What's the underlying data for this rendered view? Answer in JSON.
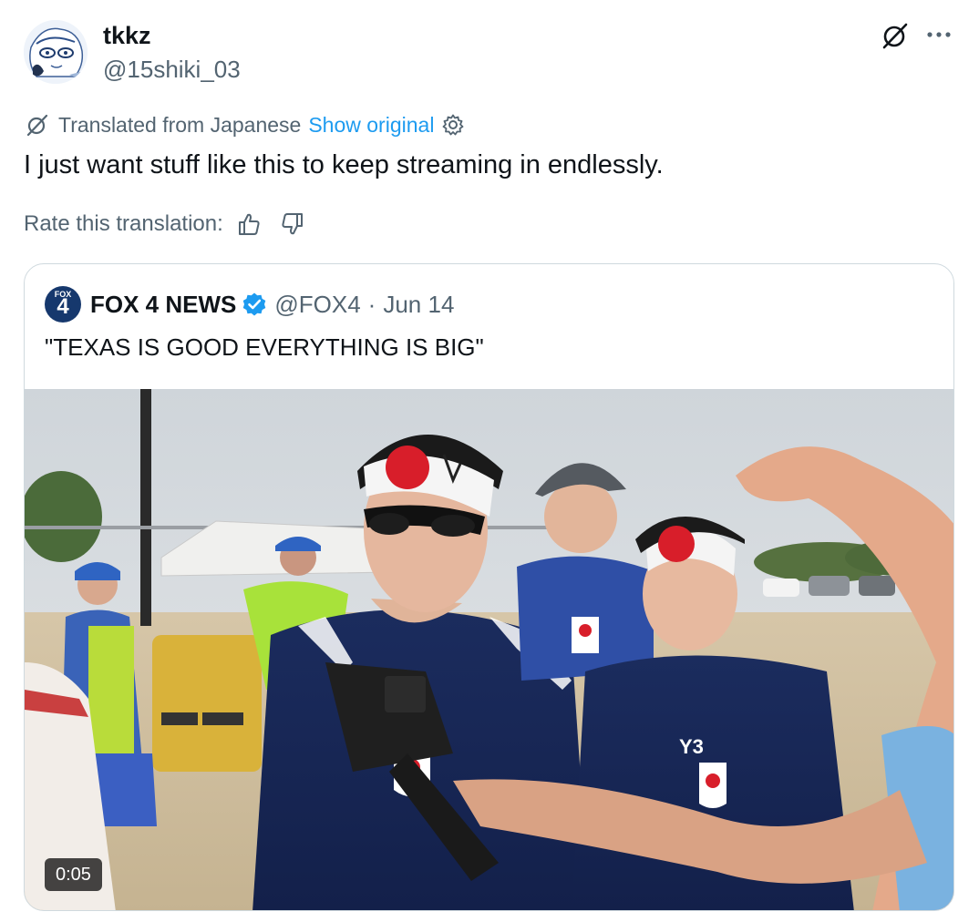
{
  "author": {
    "display_name": "tkkz",
    "handle": "@15shiki_03"
  },
  "translation": {
    "translated_from": "Translated from Japanese",
    "show_original": "Show original",
    "text": "I just want stuff like this to keep streaming in endlessly.",
    "rate_label": "Rate this translation:"
  },
  "quote": {
    "logo_text": "FOX",
    "logo_number": "4",
    "name": "FOX 4 NEWS",
    "handle": "@FOX4",
    "separator": "·",
    "date": "Jun 14",
    "text": "\"TEXAS IS GOOD EVERYTHING IS BIG\"",
    "video_duration": "0:05",
    "jersey_text": "Y3"
  },
  "icons": {
    "grok": "grok-icon",
    "more": "more-icon",
    "translate": "translate-icon",
    "settings": "settings-gear-icon",
    "thumbs_up": "thumbs-up-icon",
    "thumbs_down": "thumbs-down-icon",
    "verified": "verified-badge-icon"
  },
  "colors": {
    "link_blue": "#1d9bf0",
    "secondary_text": "#536471",
    "verified_blue": "#1d9bf0",
    "fox_navy": "#16386d"
  }
}
